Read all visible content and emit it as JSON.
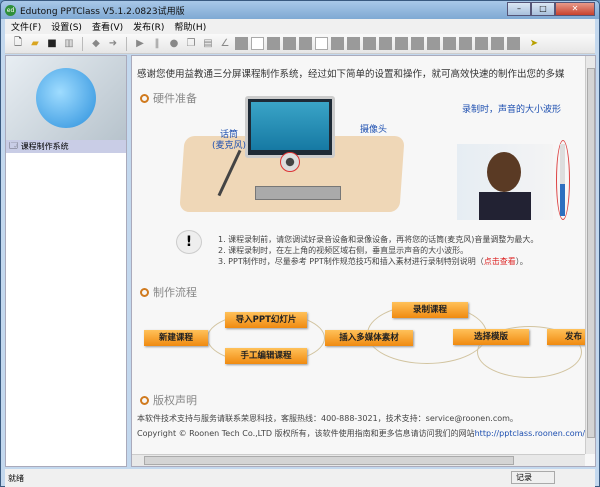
{
  "window": {
    "title": "Edutong PPTClass V5.1.2.0823试用版",
    "app_icon": "ed",
    "minimize": "–",
    "maximize": "□",
    "close": "✕"
  },
  "menu": [
    "文件(F)",
    "设置(S)",
    "查看(V)",
    "发布(R)",
    "帮助(H)"
  ],
  "sidebar": {
    "items": [
      {
        "label": "课程制作系统"
      }
    ]
  },
  "intro": "感谢您使用益教通三分屏课程制作系统，经过如下简单的设置和操作，就可高效快速的制作出您的多媒",
  "hardware": {
    "title": "硬件准备",
    "mic_label_1": "话筒",
    "mic_label_2": "(麦克风)",
    "camera_label": "摄像头",
    "wave_label": "录制时，声音的大小波形",
    "volume_level": 0.45
  },
  "tips": {
    "line1": "1. 课程录制前，请您调试好录音设备和录像设备，再将您的话筒(麦克风)音量调整为最大。",
    "line2": "2. 课程录制时，在左上角的视频区域右侧，垂直显示声音的大小波形。",
    "line3_pre": "3. PPT制作时，尽量参考 PPT制作规范技巧和插入素材进行录制特别说明（",
    "line3_link": "点击查看",
    "line3_post": "）。"
  },
  "flow": {
    "title": "制作流程",
    "steps": [
      "新建课程",
      "导入PPT幻灯片",
      "手工编辑课程",
      "插入多媒体素材",
      "录制课程",
      "选择模版",
      "发布"
    ]
  },
  "copyright": {
    "title": "版权声明",
    "line1": "本软件技术支持与服务请联系荣恩科技，客服热线：400-888-3021，技术支持：service@roonen.com。",
    "line2": "Copyright © Roonen Tech Co.,LTD 版权所有，该软件使用指南和更多信息请访问我们的网站",
    "link": "http://pptclass.roonen.com/"
  },
  "status": {
    "left": "就绪",
    "right": "记录"
  },
  "colors": {
    "accent": "#d07a1e",
    "box": "#f08a10",
    "link": "#1d4fb0"
  }
}
